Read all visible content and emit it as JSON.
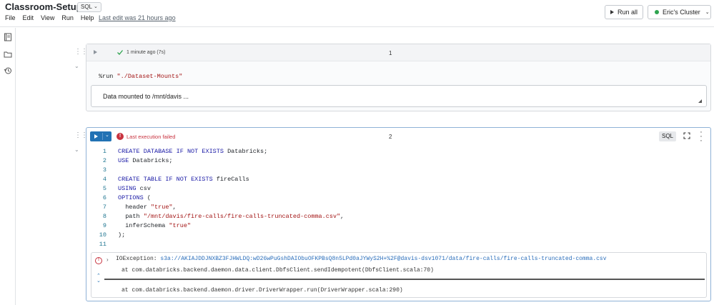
{
  "header": {
    "title": "Classroom-Setup",
    "language": "SQL",
    "menu": [
      "File",
      "Edit",
      "View",
      "Run",
      "Help"
    ],
    "last_edit": "Last edit was 21 hours ago",
    "run_all": "Run all",
    "cluster": "Eric's Cluster"
  },
  "rail": {
    "icons": [
      "notebook-icon",
      "folder-icon",
      "revision-history-icon"
    ]
  },
  "cell1": {
    "number": "1",
    "status": "1 minute ago (7s)",
    "command_prefix": "%run ",
    "command_arg": "\"./Dataset-Mounts\"",
    "result": "Data mounted to /mnt/davis ..."
  },
  "cell2": {
    "number": "2",
    "status": "Last execution failed",
    "language": "SQL",
    "error_type": "IOException: ",
    "error_path": "s3a://AKIAJDDJNXBZ3FJHWLDQ:wD26wPuGshDAIObuOFKPBsQ8n5LPd0aJYWyS2H+%2F@davis-dsv1071/data/fire-calls/fire-calls-truncated-comma.csv",
    "trace_1": "at com.databricks.backend.daemon.data.client.DbfsClient.sendIdempotent(DbfsClient.scala:70)",
    "trace_2": "at com.databricks.backend.daemon.driver.DriverWrapper.run(DriverWrapper.scala:290)",
    "code_lines": [
      "CREATE DATABASE IF NOT EXISTS Databricks;",
      "USE Databricks;",
      "",
      "CREATE TABLE IF NOT EXISTS fireCalls",
      "USING csv",
      "OPTIONS (",
      "  header \"true\",",
      "  path \"/mnt/davis/fire-calls/fire-calls-truncated-comma.csv\",",
      "  inferSchema \"true\"",
      ");",
      ""
    ]
  },
  "colors": {
    "accent": "#2272b4",
    "error": "#c8333f",
    "success": "#2ea44f",
    "keyword": "#1a1aa6",
    "string": "#a31515"
  }
}
